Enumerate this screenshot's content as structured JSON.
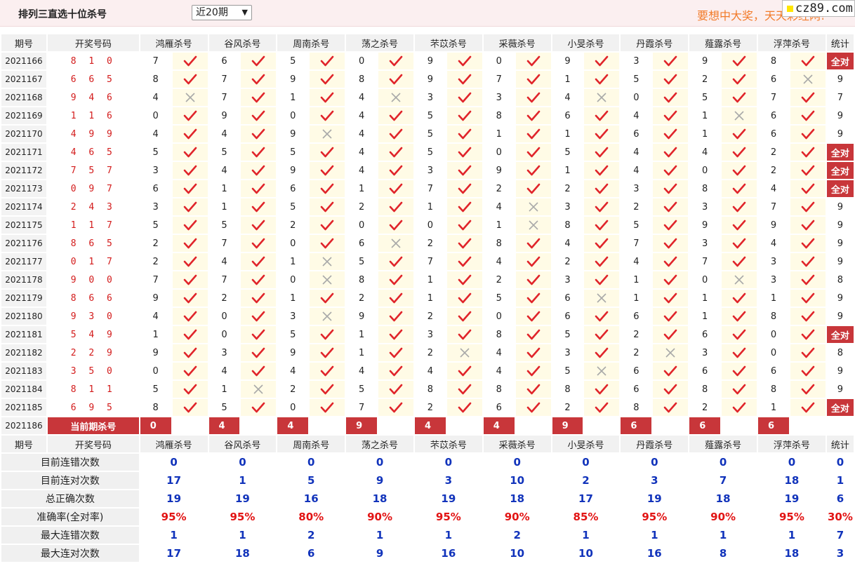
{
  "header": {
    "title": "排列三直选十位杀号",
    "period_selected": "近20期",
    "promo": "要想中大奖，天天彩经网!",
    "logo": "cz89.com"
  },
  "columns": {
    "issue": "期号",
    "draw": "开奖号码",
    "experts": [
      "鸿雁杀号",
      "谷风杀号",
      "周南杀号",
      "荡之杀号",
      "芣苡杀号",
      "采薇杀号",
      "小旻杀号",
      "丹霞杀号",
      "薤露杀号",
      "浮萍杀号"
    ],
    "stat": "统计"
  },
  "rows": [
    {
      "issue": "2021166",
      "draw": "8 1 0",
      "kills": [
        "7",
        "6",
        "5",
        "0",
        "9",
        "0",
        "9",
        "3",
        "9",
        "8"
      ],
      "ok": [
        1,
        1,
        1,
        1,
        1,
        1,
        1,
        1,
        1,
        1
      ],
      "stat": "全对"
    },
    {
      "issue": "2021167",
      "draw": "6 6 5",
      "kills": [
        "8",
        "7",
        "9",
        "8",
        "9",
        "7",
        "1",
        "5",
        "2",
        "6"
      ],
      "ok": [
        1,
        1,
        1,
        1,
        1,
        1,
        1,
        1,
        1,
        0
      ],
      "stat": "9"
    },
    {
      "issue": "2021168",
      "draw": "9 4 6",
      "kills": [
        "4",
        "7",
        "1",
        "4",
        "3",
        "3",
        "4",
        "0",
        "5",
        "7"
      ],
      "ok": [
        0,
        1,
        1,
        0,
        1,
        1,
        0,
        1,
        1,
        1
      ],
      "stat": "7"
    },
    {
      "issue": "2021169",
      "draw": "1 1 6",
      "kills": [
        "0",
        "9",
        "0",
        "4",
        "5",
        "8",
        "6",
        "4",
        "1",
        "6"
      ],
      "ok": [
        1,
        1,
        1,
        1,
        1,
        1,
        1,
        1,
        0,
        1
      ],
      "stat": "9"
    },
    {
      "issue": "2021170",
      "draw": "4 9 9",
      "kills": [
        "4",
        "4",
        "9",
        "4",
        "5",
        "1",
        "1",
        "6",
        "1",
        "6"
      ],
      "ok": [
        1,
        1,
        0,
        1,
        1,
        1,
        1,
        1,
        1,
        1
      ],
      "stat": "9"
    },
    {
      "issue": "2021171",
      "draw": "4 6 5",
      "kills": [
        "5",
        "5",
        "5",
        "4",
        "5",
        "0",
        "5",
        "4",
        "4",
        "2"
      ],
      "ok": [
        1,
        1,
        1,
        1,
        1,
        1,
        1,
        1,
        1,
        1
      ],
      "stat": "全对"
    },
    {
      "issue": "2021172",
      "draw": "7 5 7",
      "kills": [
        "3",
        "4",
        "9",
        "4",
        "3",
        "9",
        "1",
        "4",
        "0",
        "2"
      ],
      "ok": [
        1,
        1,
        1,
        1,
        1,
        1,
        1,
        1,
        1,
        1
      ],
      "stat": "全对"
    },
    {
      "issue": "2021173",
      "draw": "0 9 7",
      "kills": [
        "6",
        "1",
        "6",
        "1",
        "7",
        "2",
        "2",
        "3",
        "8",
        "4"
      ],
      "ok": [
        1,
        1,
        1,
        1,
        1,
        1,
        1,
        1,
        1,
        1
      ],
      "stat": "全对"
    },
    {
      "issue": "2021174",
      "draw": "2 4 3",
      "kills": [
        "3",
        "1",
        "5",
        "2",
        "1",
        "4",
        "3",
        "2",
        "3",
        "7"
      ],
      "ok": [
        1,
        1,
        1,
        1,
        1,
        0,
        1,
        1,
        1,
        1
      ],
      "stat": "9"
    },
    {
      "issue": "2021175",
      "draw": "1 1 7",
      "kills": [
        "5",
        "5",
        "2",
        "0",
        "0",
        "1",
        "8",
        "5",
        "9",
        "9"
      ],
      "ok": [
        1,
        1,
        1,
        1,
        1,
        0,
        1,
        1,
        1,
        1
      ],
      "stat": "9"
    },
    {
      "issue": "2021176",
      "draw": "8 6 5",
      "kills": [
        "2",
        "7",
        "0",
        "6",
        "2",
        "8",
        "4",
        "7",
        "3",
        "4"
      ],
      "ok": [
        1,
        1,
        1,
        0,
        1,
        1,
        1,
        1,
        1,
        1
      ],
      "stat": "9"
    },
    {
      "issue": "2021177",
      "draw": "0 1 7",
      "kills": [
        "2",
        "4",
        "1",
        "5",
        "7",
        "4",
        "2",
        "4",
        "7",
        "3"
      ],
      "ok": [
        1,
        1,
        0,
        1,
        1,
        1,
        1,
        1,
        1,
        1
      ],
      "stat": "9"
    },
    {
      "issue": "2021178",
      "draw": "9 0 0",
      "kills": [
        "7",
        "7",
        "0",
        "8",
        "1",
        "2",
        "3",
        "1",
        "0",
        "3"
      ],
      "ok": [
        1,
        1,
        0,
        1,
        1,
        1,
        1,
        1,
        0,
        1
      ],
      "stat": "8"
    },
    {
      "issue": "2021179",
      "draw": "8 6 6",
      "kills": [
        "9",
        "2",
        "1",
        "2",
        "1",
        "5",
        "6",
        "1",
        "1",
        "1"
      ],
      "ok": [
        1,
        1,
        1,
        1,
        1,
        1,
        0,
        1,
        1,
        1
      ],
      "stat": "9"
    },
    {
      "issue": "2021180",
      "draw": "9 3 0",
      "kills": [
        "4",
        "0",
        "3",
        "9",
        "2",
        "0",
        "6",
        "6",
        "1",
        "8"
      ],
      "ok": [
        1,
        1,
        0,
        1,
        1,
        1,
        1,
        1,
        1,
        1
      ],
      "stat": "9"
    },
    {
      "issue": "2021181",
      "draw": "5 4 9",
      "kills": [
        "1",
        "0",
        "5",
        "1",
        "3",
        "8",
        "5",
        "2",
        "6",
        "0"
      ],
      "ok": [
        1,
        1,
        1,
        1,
        1,
        1,
        1,
        1,
        1,
        1
      ],
      "stat": "全对"
    },
    {
      "issue": "2021182",
      "draw": "2 2 9",
      "kills": [
        "9",
        "3",
        "9",
        "1",
        "2",
        "4",
        "3",
        "2",
        "3",
        "0"
      ],
      "ok": [
        1,
        1,
        1,
        1,
        0,
        1,
        1,
        0,
        1,
        1
      ],
      "stat": "8"
    },
    {
      "issue": "2021183",
      "draw": "3 5 0",
      "kills": [
        "0",
        "4",
        "4",
        "4",
        "4",
        "4",
        "5",
        "6",
        "6",
        "6"
      ],
      "ok": [
        1,
        1,
        1,
        1,
        1,
        1,
        0,
        1,
        1,
        1
      ],
      "stat": "9"
    },
    {
      "issue": "2021184",
      "draw": "8 1 1",
      "kills": [
        "5",
        "1",
        "2",
        "5",
        "8",
        "8",
        "8",
        "6",
        "8",
        "8"
      ],
      "ok": [
        1,
        0,
        1,
        1,
        1,
        1,
        1,
        1,
        1,
        1
      ],
      "stat": "9"
    },
    {
      "issue": "2021185",
      "draw": "6 9 5",
      "kills": [
        "8",
        "5",
        "0",
        "7",
        "2",
        "6",
        "2",
        "8",
        "2",
        "1"
      ],
      "ok": [
        1,
        1,
        1,
        1,
        1,
        1,
        1,
        1,
        1,
        1
      ],
      "stat": "全对"
    }
  ],
  "current": {
    "issue": "2021186",
    "label": "当前期杀号",
    "kills": [
      "0",
      "4",
      "4",
      "9",
      "4",
      "4",
      "9",
      "6",
      "6",
      "6"
    ]
  },
  "stats": [
    {
      "label": "目前连错次数",
      "values": [
        "0",
        "0",
        "0",
        "0",
        "0",
        "0",
        "0",
        "0",
        "0",
        "0",
        "0"
      ],
      "red": false
    },
    {
      "label": "目前连对次数",
      "values": [
        "17",
        "1",
        "5",
        "9",
        "3",
        "10",
        "2",
        "3",
        "7",
        "18",
        "1"
      ],
      "red": false
    },
    {
      "label": "总正确次数",
      "values": [
        "19",
        "19",
        "16",
        "18",
        "19",
        "18",
        "17",
        "19",
        "18",
        "19",
        "6"
      ],
      "red": false
    },
    {
      "label": "准确率(全对率)",
      "values": [
        "95%",
        "95%",
        "80%",
        "90%",
        "95%",
        "90%",
        "85%",
        "95%",
        "90%",
        "95%",
        "30%"
      ],
      "red": true
    },
    {
      "label": "最大连错次数",
      "values": [
        "1",
        "1",
        "2",
        "1",
        "1",
        "2",
        "1",
        "1",
        "1",
        "1",
        "7"
      ],
      "red": false
    },
    {
      "label": "最大连对次数",
      "values": [
        "17",
        "18",
        "6",
        "9",
        "16",
        "10",
        "10",
        "16",
        "8",
        "18",
        "3"
      ],
      "red": false
    }
  ],
  "colors": {
    "accent": "#c8363a",
    "check": "#e0242a",
    "cross": "#a9a9a9",
    "stat_blue": "#1133bb",
    "promo": "#f27b2a"
  }
}
